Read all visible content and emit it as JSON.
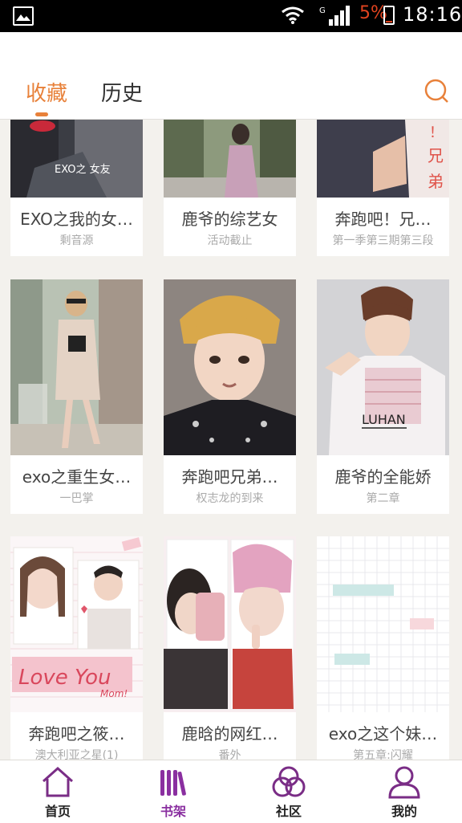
{
  "status_bar": {
    "network": "G",
    "battery_percent": "5%",
    "time": "18:16",
    "icons": [
      "gallery-icon",
      "wifi-icon",
      "signal-icon",
      "battery-icon"
    ]
  },
  "header": {
    "tabs": [
      {
        "label": "收藏",
        "active": true
      },
      {
        "label": "历史",
        "active": false
      }
    ],
    "search_icon": "search-icon",
    "accent_color": "#e8813a"
  },
  "books": [
    {
      "title": "EXO之我的女…",
      "subtitle": "剩音源",
      "cover_text": "EXO之 女友"
    },
    {
      "title": "鹿爷的综艺女",
      "subtitle": "活动截止",
      "cover_text": ""
    },
    {
      "title": "奔跑吧！兄…",
      "subtitle": "第一季第三期第三段",
      "cover_text": "！ 兄 弟"
    },
    {
      "title": "exo之重生女…",
      "subtitle": "一巴掌",
      "cover_text": ""
    },
    {
      "title": "奔跑吧兄弟…",
      "subtitle": "权志龙的到来",
      "cover_text": ""
    },
    {
      "title": "鹿爷的全能娇",
      "subtitle": "第二章",
      "cover_text": "LUHAN"
    },
    {
      "title": "奔跑吧之筱…",
      "subtitle": "澳大利亚之星(1)",
      "cover_text": "Love You",
      "cover_text2": "Mom!"
    },
    {
      "title": "鹿晗的网红…",
      "subtitle": "番外",
      "cover_text": ""
    },
    {
      "title": "exo之这个妹…",
      "subtitle": "第五章:闪耀",
      "cover_text": ""
    }
  ],
  "bottom_nav": [
    {
      "label": "首页",
      "icon": "home-icon",
      "active": false
    },
    {
      "label": "书架",
      "icon": "bookshelf-icon",
      "active": true
    },
    {
      "label": "社区",
      "icon": "community-icon",
      "active": false
    },
    {
      "label": "我的",
      "icon": "profile-icon",
      "active": false
    }
  ],
  "colors": {
    "nav_active": "#8a2fa0",
    "background": "#f3f1ed"
  }
}
